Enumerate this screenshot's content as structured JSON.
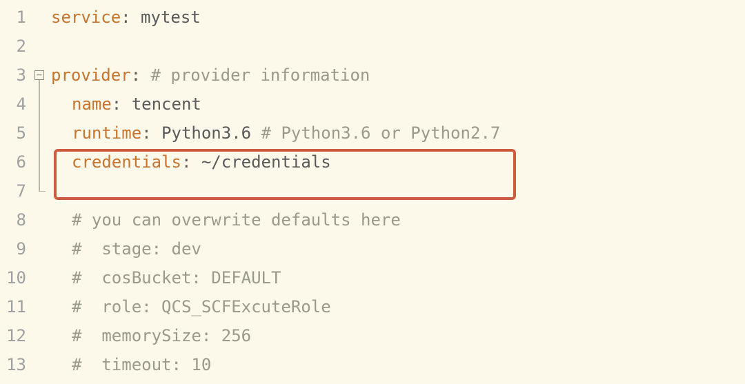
{
  "gutter": [
    "1",
    "2",
    "3",
    "4",
    "5",
    "6",
    "7",
    "8",
    "9",
    "10",
    "11",
    "12",
    "13"
  ],
  "lines": {
    "l1_key": "service",
    "l1_val": " mytest",
    "l3_key": "provider",
    "l3_comment": " # provider information",
    "l4_key": "name",
    "l4_val": " tencent",
    "l5_key": "runtime",
    "l5_val": " Python3.6",
    "l5_comment": " # Python3.6 or Python2.7",
    "l6_key": "credentials",
    "l6_val": " ~/credentials",
    "l8": "# you can overwrite defaults here",
    "l9": "#  stage: dev",
    "l10": "#  cosBucket: DEFAULT",
    "l11": "#  role: QCS_SCFExcuteRole",
    "l12": "#  memorySize: 256",
    "l13": "#  timeout: 10"
  },
  "colon": ":",
  "fold_symbol": "−"
}
